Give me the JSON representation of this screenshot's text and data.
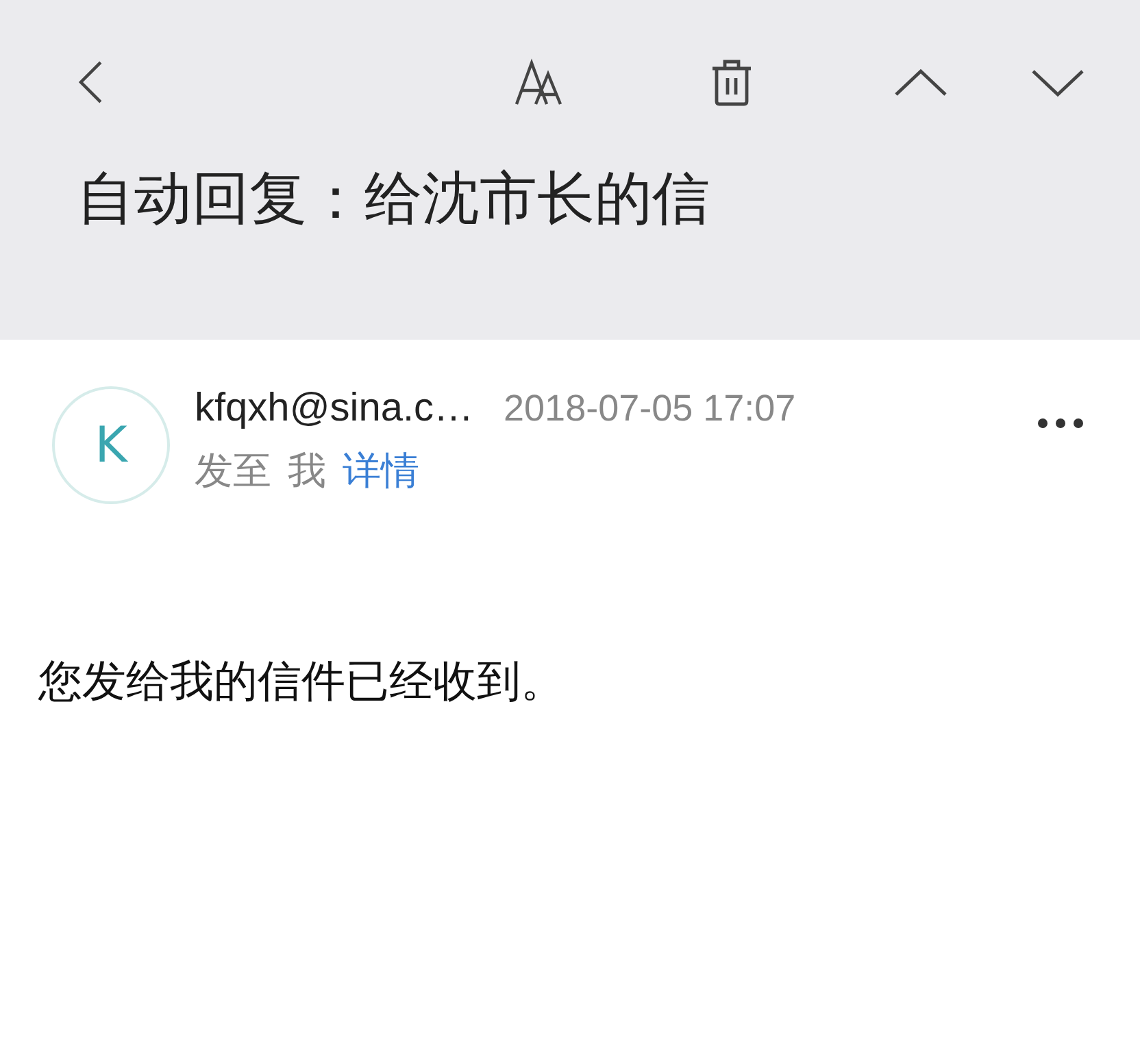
{
  "title": "自动回复：给沈市长的信",
  "sender": {
    "avatar_letter": "K",
    "address": "kfqxh@sina.c…",
    "date": "2018-07-05 17:07",
    "recipient_prefix": "发至",
    "recipient": "我",
    "details_link": "详情"
  },
  "body": "您发给我的信件已经收到。"
}
